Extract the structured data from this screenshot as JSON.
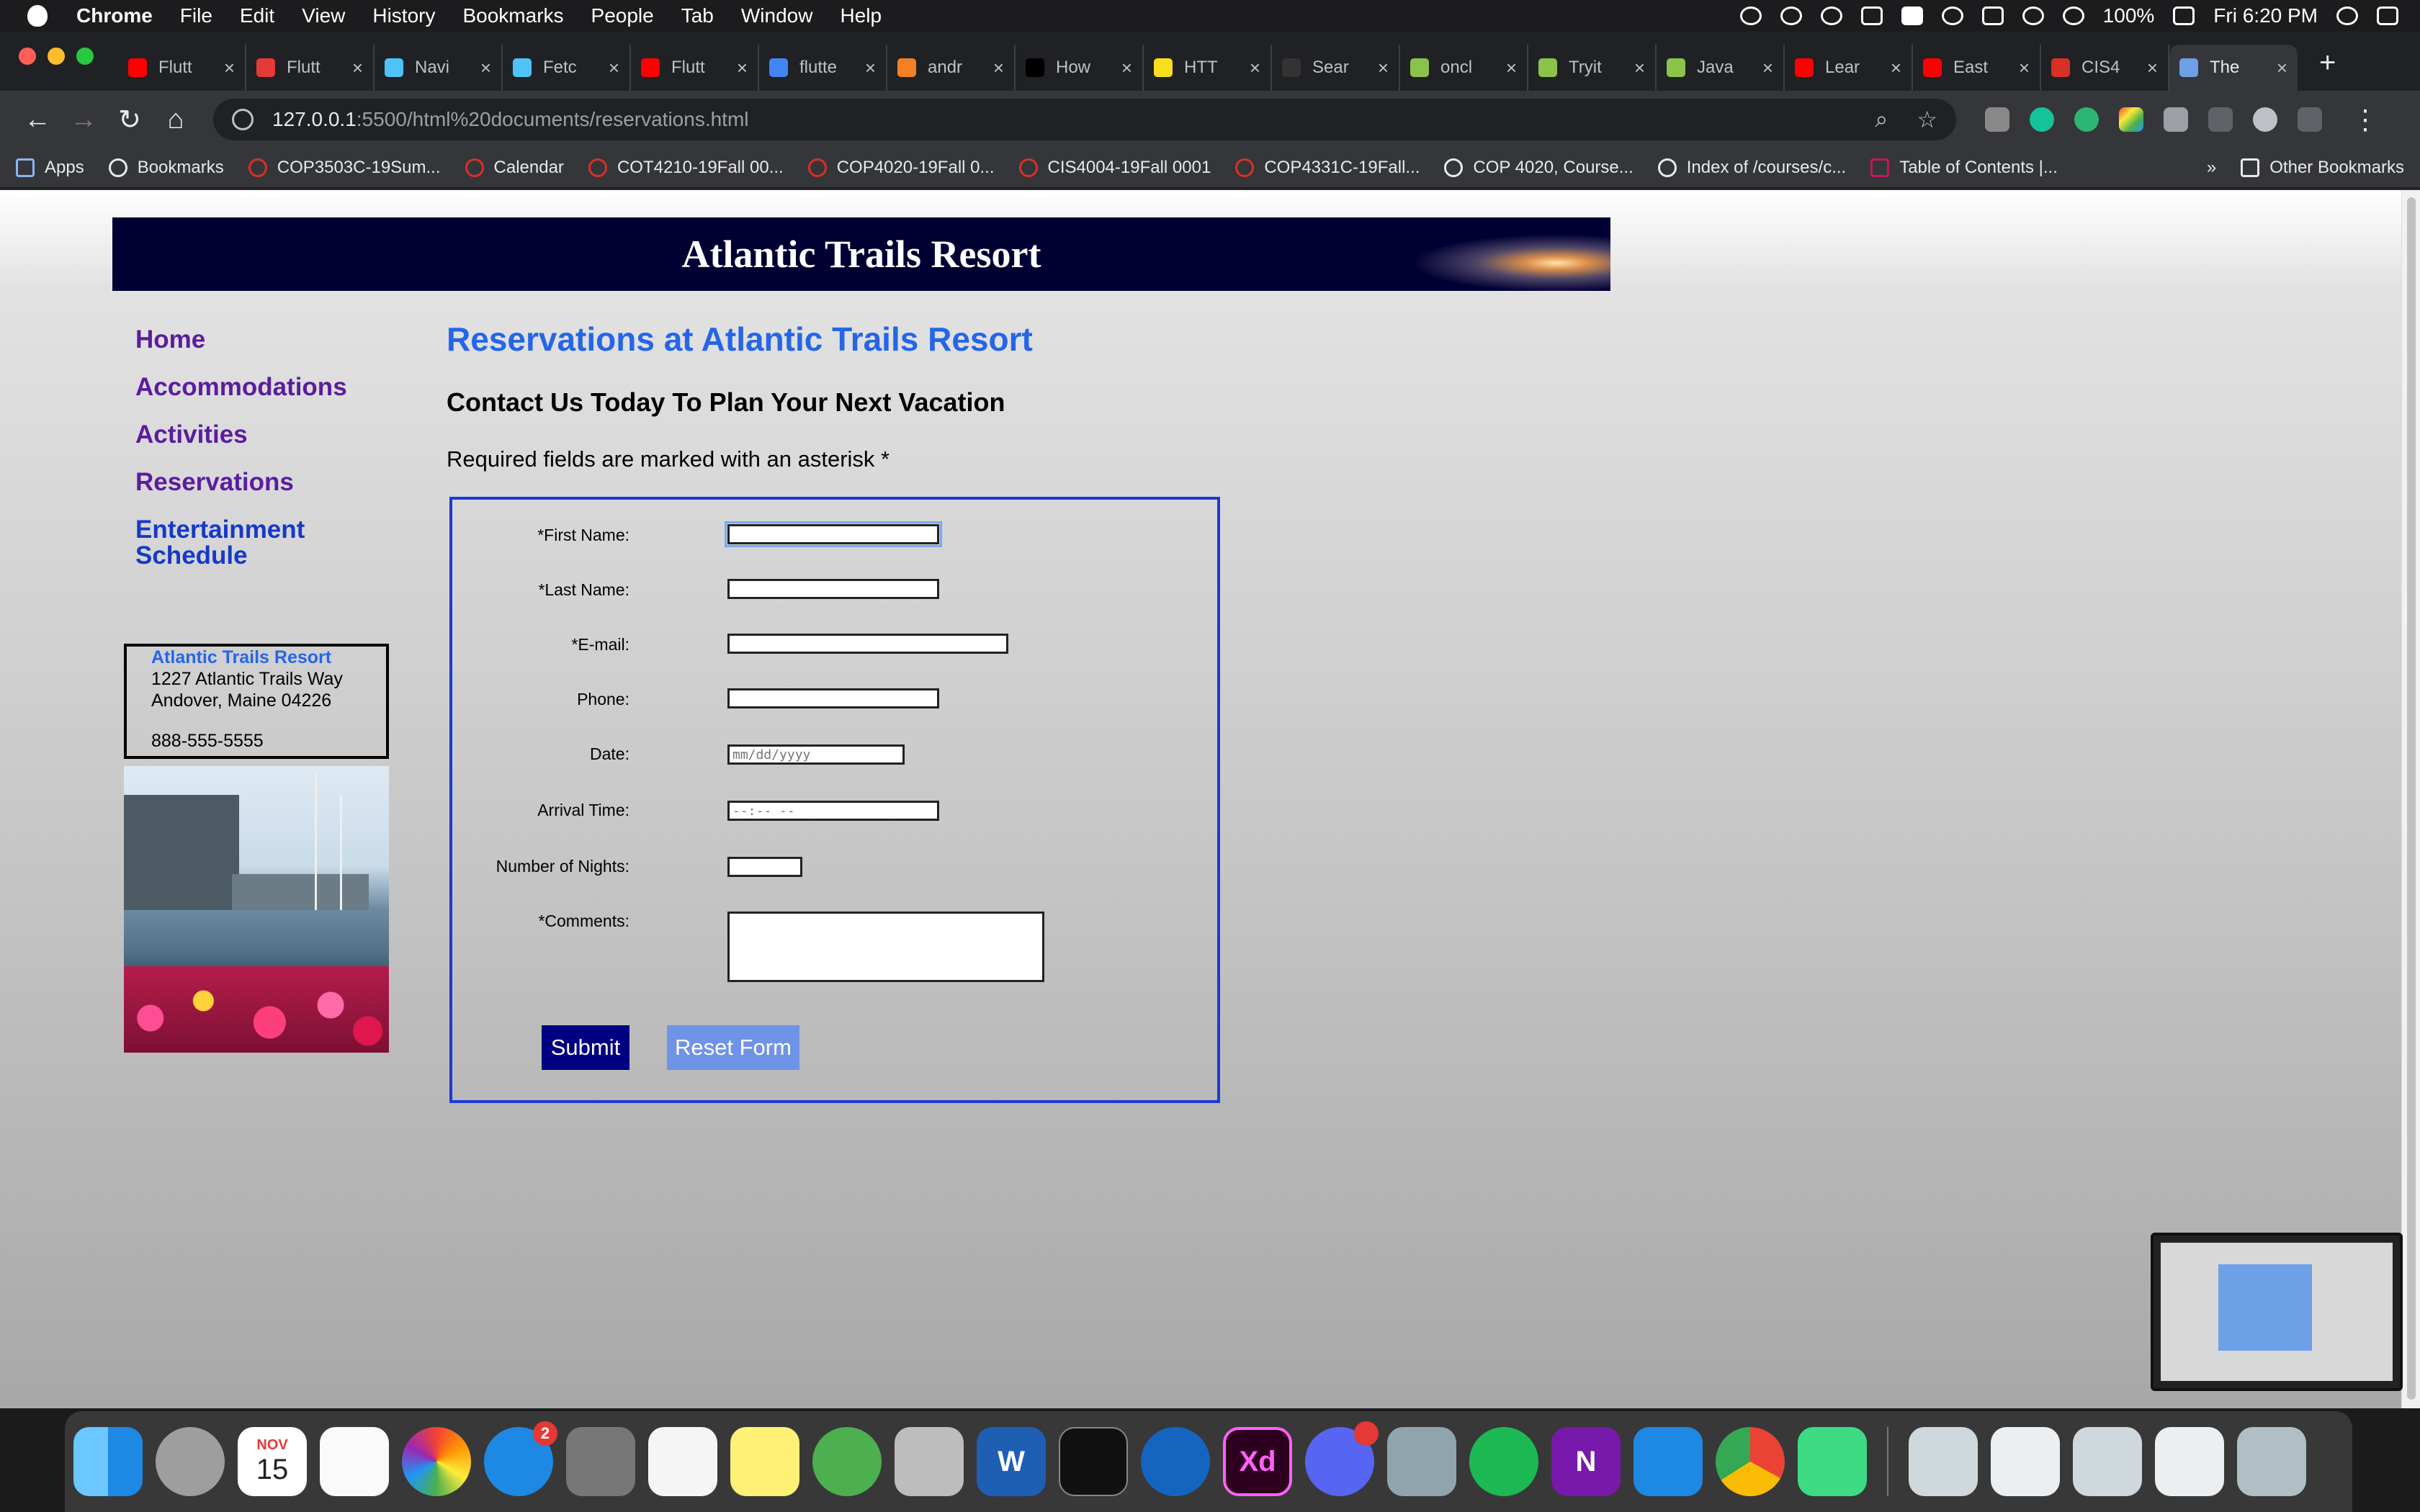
{
  "menubar": {
    "items": [
      "Chrome",
      "File",
      "Edit",
      "View",
      "History",
      "Bookmarks",
      "People",
      "Tab",
      "Window",
      "Help"
    ],
    "battery": "100%",
    "clock": "Fri 6:20 PM"
  },
  "tabs": [
    {
      "label": "Flutt",
      "color": "#ff0000"
    },
    {
      "label": "Flutt",
      "color": "#e53935"
    },
    {
      "label": "Navi",
      "color": "#4fc3f7"
    },
    {
      "label": "Fetc",
      "color": "#4fc3f7"
    },
    {
      "label": "Flutt",
      "color": "#ff0000"
    },
    {
      "label": "flutte",
      "color": "#4285f4"
    },
    {
      "label": "andr",
      "color": "#f48024"
    },
    {
      "label": "How",
      "color": "#000000"
    },
    {
      "label": "HTT",
      "color": "#f7df1e"
    },
    {
      "label": "Sear",
      "color": "#333333"
    },
    {
      "label": "oncl",
      "color": "#8bc34a"
    },
    {
      "label": "Tryit",
      "color": "#8bc34a"
    },
    {
      "label": "Java",
      "color": "#8bc34a"
    },
    {
      "label": "Lear",
      "color": "#ff0000"
    },
    {
      "label": "East",
      "color": "#ff0000"
    },
    {
      "label": "CIS4",
      "color": "#d93025"
    },
    {
      "label": "The",
      "color": "#6da0e6",
      "active": true
    }
  ],
  "toolbar": {
    "url_host": "127.0.0.1",
    "url_rest": ":5500/html%20documents/reservations.html"
  },
  "bookmarks": {
    "items": [
      "Apps",
      "Bookmarks",
      "COP3503C-19Sum...",
      "Calendar",
      "COT4210-19Fall 00...",
      "COP4020-19Fall 0...",
      "CIS4004-19Fall 0001",
      "COP4331C-19Fall...",
      "COP 4020, Course...",
      "Index of /courses/c...",
      "Table of Contents |..."
    ],
    "overflow": "»",
    "other": "Other Bookmarks"
  },
  "site": {
    "header_title": "Atlantic Trails Resort",
    "nav": [
      "Home",
      "Accommodations",
      "Activities",
      "Reservations",
      "Entertainment Schedule"
    ],
    "address": {
      "name": "Atlantic Trails Resort",
      "street": "1227 Atlantic Trails Way",
      "city": "Andover, Maine 04226",
      "phone": "888-555-5555"
    },
    "page_title": "Reservations at Atlantic Trails Resort",
    "subtitle": "Contact Us Today To Plan Your Next Vacation",
    "required_note": "Required fields are marked with an asterisk *"
  },
  "form": {
    "first_name_label": "*First Name:",
    "last_name_label": "*Last Name:",
    "email_label": "*E-mail:",
    "phone_label": "Phone:",
    "date_label": "Date:",
    "date_placeholder": "mm/dd/yyyy",
    "arrival_label": "Arrival Time:",
    "arrival_placeholder": "--:-- --",
    "nights_label": "Number of Nights:",
    "comments_label": "*Comments:",
    "submit_label": "Submit",
    "reset_label": "Reset Form"
  },
  "dock": {
    "calendar_month": "NOV",
    "calendar_day": "15",
    "appstore_badge": "2",
    "word_letter": "W",
    "xd_letters": "Xd",
    "onenote_letter": "N"
  }
}
